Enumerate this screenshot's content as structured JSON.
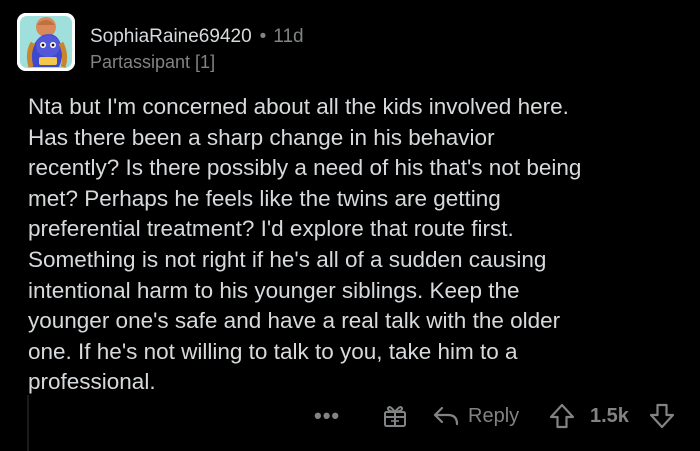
{
  "comment": {
    "author": "SophiaRaine69420",
    "separator": "•",
    "age": "11d",
    "flair": "Partassipant [1]",
    "body_lines": [
      "Nta but I'm concerned about all the kids involved here.",
      "Has there been a sharp change in his behavior",
      "recently? Is there possibly a need of his that's not being",
      "met? Perhaps he feels like the twins are getting",
      "preferential treatment? I'd explore that route first.",
      "Something is not right if he's all of a sudden causing",
      "intentional harm to his younger siblings. Keep the",
      "younger one's safe and have a real talk with the older",
      "one. If he's not willing to talk to you, take him to a",
      "professional."
    ]
  },
  "actions": {
    "more_label": "•••",
    "reply_label": "Reply",
    "score": "1.5k"
  },
  "icons": {
    "avatar": "snoo-avatar-icon",
    "award": "gift-award-icon",
    "reply": "reply-arrow-icon",
    "upvote": "upvote-arrow-icon",
    "downvote": "downvote-arrow-icon"
  },
  "colors": {
    "background": "#000000",
    "text": "#d7dadc",
    "meta": "#818384"
  }
}
